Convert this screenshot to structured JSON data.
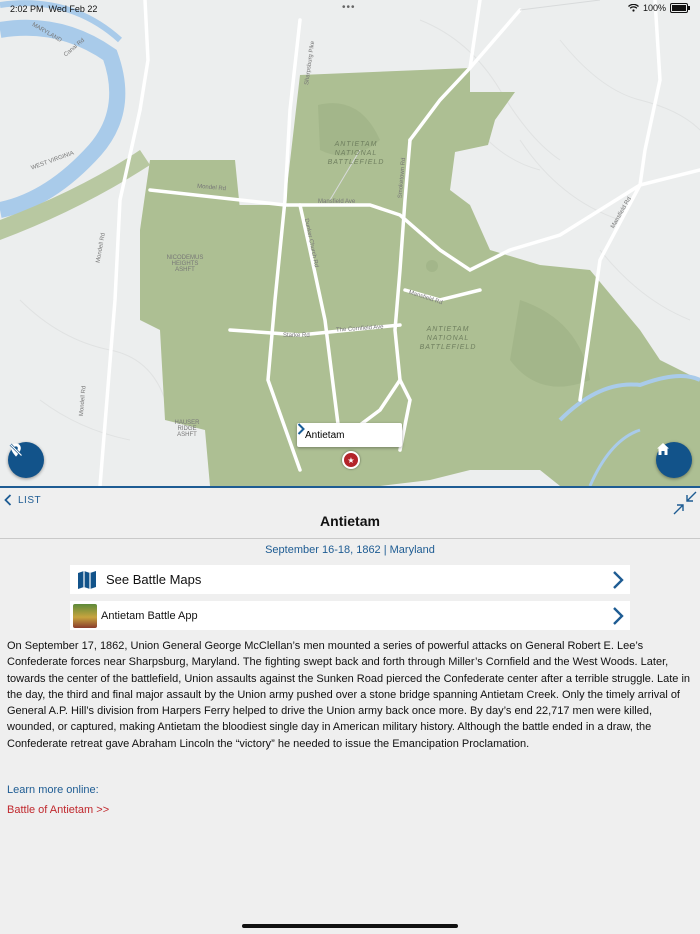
{
  "status_bar": {
    "time": "2:02 PM",
    "date": "Wed Feb 22",
    "battery": "100%"
  },
  "map": {
    "road_labels": [
      "Sharpsburg Pike",
      "Mondel Rd",
      "Mansfield Ave",
      "Smoketown Rd",
      "Starke Rd",
      "The Cornfield Ave",
      "Dunker Church Rd",
      "Mansfield Rd",
      "Mondell Rd",
      "Canal Rd",
      "Mondell Rd",
      "Mansfield Rd"
    ],
    "park_labels": [
      "ANTIETAM NATIONAL BATTLEFIELD",
      "ANTIETAM NATIONAL BATTLEFIELD"
    ],
    "area_labels": [
      "NICODEMUS HEIGHTS ASHFT",
      "HAUSER RIDGE ASHFT",
      "MARYLAND",
      "WEST VIRGINIA"
    ],
    "popup": {
      "label": "Antietam"
    },
    "left_button_icon": "location-off-icon",
    "right_button_icon": "home-icon"
  },
  "panel": {
    "back_label": "LIST",
    "title": "Antietam",
    "subtitle": "September 16-18, 1862 | Maryland",
    "rows": [
      {
        "label": "See Battle Maps",
        "icon": "map-icon"
      },
      {
        "label": "Antietam Battle App",
        "icon": "app-thumbnail"
      }
    ],
    "description": "On September 17, 1862, Union General George McClellan’s men mounted a series of powerful attacks on General Robert E. Lee’s Confederate forces near Sharpsburg, Maryland. The fighting swept back and forth through Miller’s Cornfield and the West Woods. Later, towards the center of the battlefield, Union assaults against the Sunken Road pierced the Confederate center after a terrible struggle. Late in the day, the third and final major assault by the Union army pushed over a stone bridge spanning Antietam Creek. Only the timely arrival of General A.P. Hill’s division from Harpers Ferry helped to drive the Union army back once more. By day’s end 22,717 men were killed, wounded, or captured, making Antietam the bloodiest single day in American military history. Although the battle ended in a draw, the Confederate retreat gave Abraham Lincoln the “victory” he needed to issue the Emancipation Proclamation.",
    "learn_more": "Learn more online:",
    "link": "Battle of Antietam >>"
  },
  "colors": {
    "accent": "#1e5c93",
    "link_red": "#c0282d",
    "park_green": "#a9bb8f",
    "water": "#a9cbea"
  }
}
